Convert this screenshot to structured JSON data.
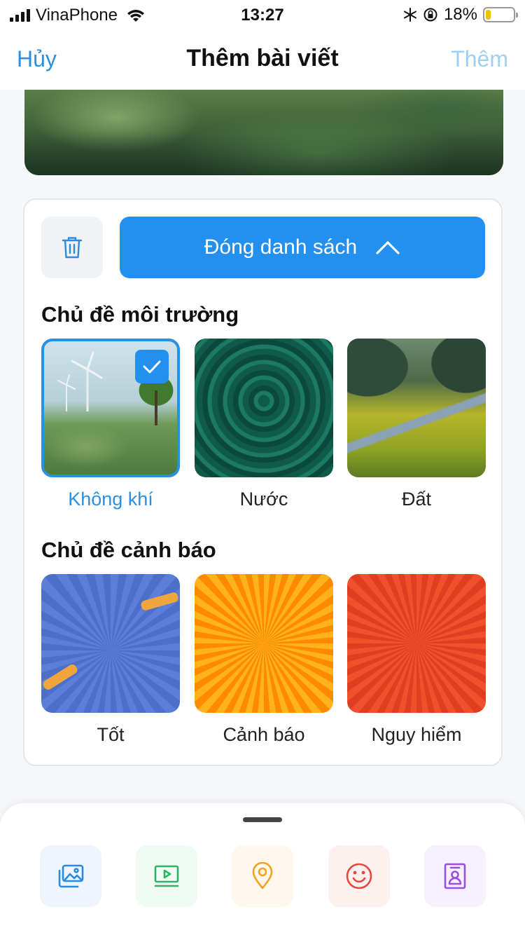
{
  "status_bar": {
    "carrier": "VinaPhone",
    "time": "13:27",
    "battery_percent": "18%",
    "battery_level": 0.18,
    "icons": [
      "signal-icon",
      "wifi-icon",
      "snowflake-icon",
      "rotation-lock-icon",
      "battery-icon"
    ]
  },
  "nav": {
    "cancel_label": "Hủy",
    "title": "Thêm bài viết",
    "add_label": "Thêm"
  },
  "panel": {
    "close_list_label": "Đóng danh sách",
    "environment_title": "Chủ đề môi trường",
    "warning_title": "Chủ đề cảnh báo"
  },
  "environment_topics": [
    {
      "label": "Không khí",
      "selected": true
    },
    {
      "label": "Nước",
      "selected": false
    },
    {
      "label": "Đất",
      "selected": false
    }
  ],
  "warning_topics": [
    {
      "label": "Tốt",
      "color": "#5b7fd6"
    },
    {
      "label": "Cảnh báo",
      "color": "#ff9a0e"
    },
    {
      "label": "Nguy hiểm",
      "color": "#ec4a26"
    }
  ],
  "toolbar": {
    "items": [
      {
        "icon": "image-gallery-icon",
        "color": "#2a8be0",
        "bg": "#eef5fd"
      },
      {
        "icon": "video-play-icon",
        "color": "#2fb36a",
        "bg": "#eefaf2"
      },
      {
        "icon": "location-pin-icon",
        "color": "#efa31f",
        "bg": "#fff7ec"
      },
      {
        "icon": "smiley-icon",
        "color": "#e5483c",
        "bg": "#fdf1f0"
      },
      {
        "icon": "contact-card-icon",
        "color": "#9b4fe0",
        "bg": "#f6f0fd"
      }
    ]
  },
  "colors": {
    "accent": "#2390f0",
    "link": "#2a90e0",
    "disabled_link": "#9fd0f3"
  }
}
